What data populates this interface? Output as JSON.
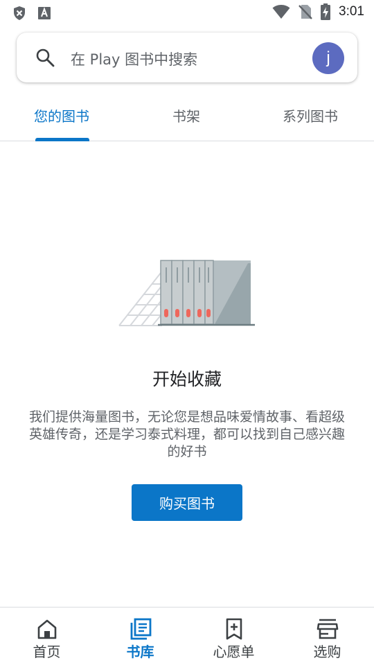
{
  "status_bar": {
    "time": "3:01",
    "left_icons": [
      "shield-x-icon",
      "font-a-icon"
    ],
    "right_icons": [
      "wifi-icon",
      "no-sim-icon",
      "battery-charging-icon"
    ]
  },
  "search": {
    "placeholder": "在 Play 图书中搜索",
    "avatar_letter": "j"
  },
  "tabs": [
    {
      "label": "您的图书",
      "active": true
    },
    {
      "label": "书架",
      "active": false
    },
    {
      "label": "系列图书",
      "active": false
    }
  ],
  "empty_state": {
    "title": "开始收藏",
    "description": "我们提供海量图书，无论您是想品味爱情故事、看超级英雄传奇，还是学习泰式料理，都可以找到自己感兴趣的好书",
    "button_label": "购买图书"
  },
  "bottom_nav": [
    {
      "label": "首页",
      "icon": "home-icon",
      "active": false
    },
    {
      "label": "书库",
      "icon": "library-icon",
      "active": true
    },
    {
      "label": "心愿单",
      "icon": "wishlist-icon",
      "active": false
    },
    {
      "label": "选购",
      "icon": "shop-icon",
      "active": false
    }
  ],
  "colors": {
    "accent": "#0b76c8",
    "avatar": "#5c6bc0",
    "text_secondary": "#5f6368"
  }
}
